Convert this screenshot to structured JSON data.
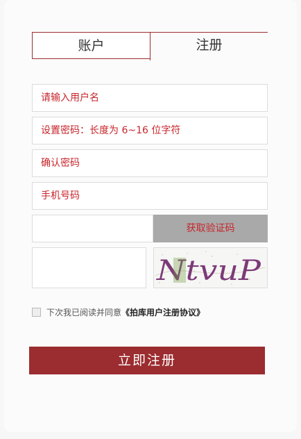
{
  "tabs": {
    "login_label": "账户",
    "register_label": "注册"
  },
  "fields": {
    "username_placeholder": "请输入用户名",
    "password_placeholder": "设置密码：长度为 6~16 位字符",
    "confirm_placeholder": "确认密码",
    "phone_placeholder": "手机号码",
    "sms_code_value": "",
    "captcha_value": ""
  },
  "sms": {
    "button_label": "获取验证码"
  },
  "captcha": {
    "image_text": "NtvuP"
  },
  "agreement": {
    "prefix": "下次我已阅读并同意",
    "link_label": "《拍库用户注册协议》",
    "checked": false
  },
  "submit": {
    "label": "立即注册"
  },
  "colors": {
    "accent": "#9b2c2f",
    "placeholder": "#c8262c",
    "sms_button_bg": "#a9a9a9"
  }
}
